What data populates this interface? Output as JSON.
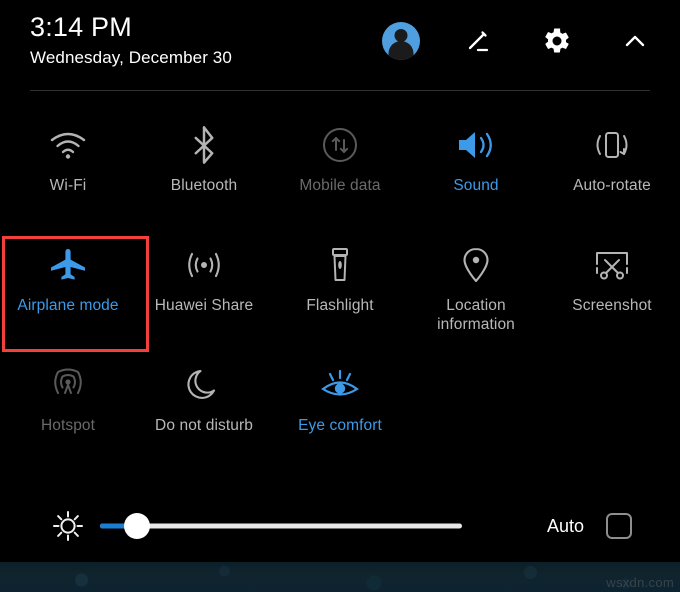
{
  "statusbar": {
    "time": "3:14 PM",
    "date": "Wednesday, December 30"
  },
  "header": {
    "icons": [
      {
        "name": "user-avatar",
        "label": "User profile"
      },
      {
        "name": "edit-icon",
        "label": "Edit"
      },
      {
        "name": "settings-gear-icon",
        "label": "Settings"
      },
      {
        "name": "chevron-up-icon",
        "label": "Collapse"
      }
    ]
  },
  "tiles": [
    [
      {
        "label": "Wi-Fi",
        "icon": "wifi-icon",
        "state": "off"
      },
      {
        "label": "Bluetooth",
        "icon": "bluetooth-icon",
        "state": "off"
      },
      {
        "label": "Mobile data",
        "icon": "mobile-data-icon",
        "state": "dim"
      },
      {
        "label": "Sound",
        "icon": "sound-icon",
        "state": "on"
      },
      {
        "label": "Auto-rotate",
        "icon": "auto-rotate-icon",
        "state": "off"
      }
    ],
    [
      {
        "label": "Airplane mode",
        "icon": "airplane-icon",
        "state": "on"
      },
      {
        "label": "Huawei Share",
        "icon": "huawei-share-icon",
        "state": "off"
      },
      {
        "label": "Flashlight",
        "icon": "flashlight-icon",
        "state": "off"
      },
      {
        "label": "Location information",
        "icon": "location-pin-icon",
        "state": "off"
      },
      {
        "label": "Screenshot",
        "icon": "screenshot-icon",
        "state": "off"
      }
    ],
    [
      {
        "label": "Hotspot",
        "icon": "hotspot-icon",
        "state": "dim"
      },
      {
        "label": "Do not disturb",
        "icon": "moon-icon",
        "state": "off"
      },
      {
        "label": "Eye comfort",
        "icon": "eye-comfort-icon",
        "state": "on"
      }
    ]
  ],
  "brightness": {
    "icon": "brightness-sun-icon",
    "value_percent": 9,
    "auto_label": "Auto",
    "auto_checked": false
  },
  "annotation": {
    "highlight_target": "Airplane mode",
    "color": "#f2413c"
  },
  "watermark": {
    "text": "wsxdn.com"
  },
  "colors": {
    "accent_blue": "#3d9ae8",
    "slider_blue": "#1a7fd4",
    "label_off": "#b8b8b8",
    "label_dim": "#6a6a6a",
    "highlight_red": "#f2413c",
    "background": "#000000"
  }
}
